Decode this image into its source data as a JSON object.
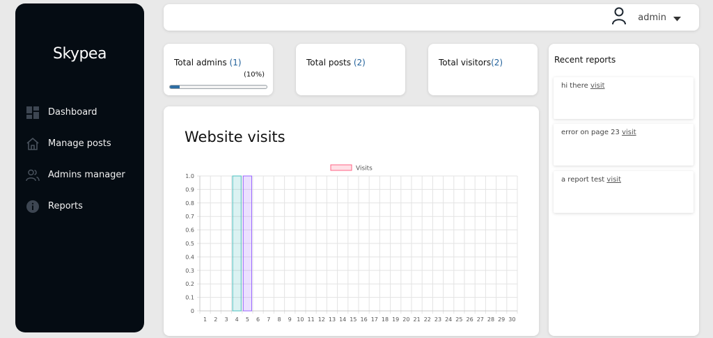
{
  "sidebar": {
    "brand": "Skypea",
    "items": [
      {
        "label": "Dashboard",
        "icon": "dashboard-icon"
      },
      {
        "label": "Manage posts",
        "icon": "home-icon"
      },
      {
        "label": "Admins manager",
        "icon": "users-icon"
      },
      {
        "label": "Reports",
        "icon": "info-icon"
      }
    ]
  },
  "header": {
    "user_name": "admin",
    "user_icon": "user-icon",
    "dropdown_icon": "caret-down-icon"
  },
  "stats": {
    "admins": {
      "label": "Total admins ",
      "count": "(1)",
      "percent_text": "(10%)",
      "progress": 0.1
    },
    "posts": {
      "label": "Total posts ",
      "count": "(2)"
    },
    "visitors": {
      "label": "Total visitors",
      "count": "(2)"
    }
  },
  "colors": {
    "sidebar_bg": "#050c13",
    "accent": "#1f5f99",
    "progress_fill": "#2d6da3"
  },
  "chart_title": "Website visits",
  "chart_data": {
    "type": "bar",
    "categories": [
      "1",
      "2",
      "3",
      "4",
      "5",
      "6",
      "7",
      "8",
      "9",
      "10",
      "11",
      "12",
      "13",
      "14",
      "15",
      "16",
      "17",
      "18",
      "19",
      "20",
      "21",
      "22",
      "23",
      "24",
      "25",
      "26",
      "27",
      "28",
      "29",
      "30"
    ],
    "series": [
      {
        "name": "Visits",
        "values": [
          0,
          0,
          0,
          1,
          1,
          0,
          0,
          0,
          0,
          0,
          0,
          0,
          0,
          0,
          0,
          0,
          0,
          0,
          0,
          0,
          0,
          0,
          0,
          0,
          0,
          0,
          0,
          0,
          0,
          0
        ]
      }
    ],
    "bar_colors": {
      "4": "#4bc0c0",
      "5": "#9966ff"
    },
    "legend_color": "#ff6384",
    "ylim": [
      0,
      1
    ],
    "yticks": [
      "0",
      "0.1",
      "0.2",
      "0.3",
      "0.4",
      "0.5",
      "0.6",
      "0.7",
      "0.8",
      "0.9",
      "1.0"
    ],
    "grid": true,
    "legend_position": "top"
  },
  "reports": {
    "title": "Recent reports",
    "items": [
      {
        "text": "hi there ",
        "link": "visit"
      },
      {
        "text": "error on page 23 ",
        "link": "visit"
      },
      {
        "text": "a report test ",
        "link": "visit"
      }
    ]
  }
}
